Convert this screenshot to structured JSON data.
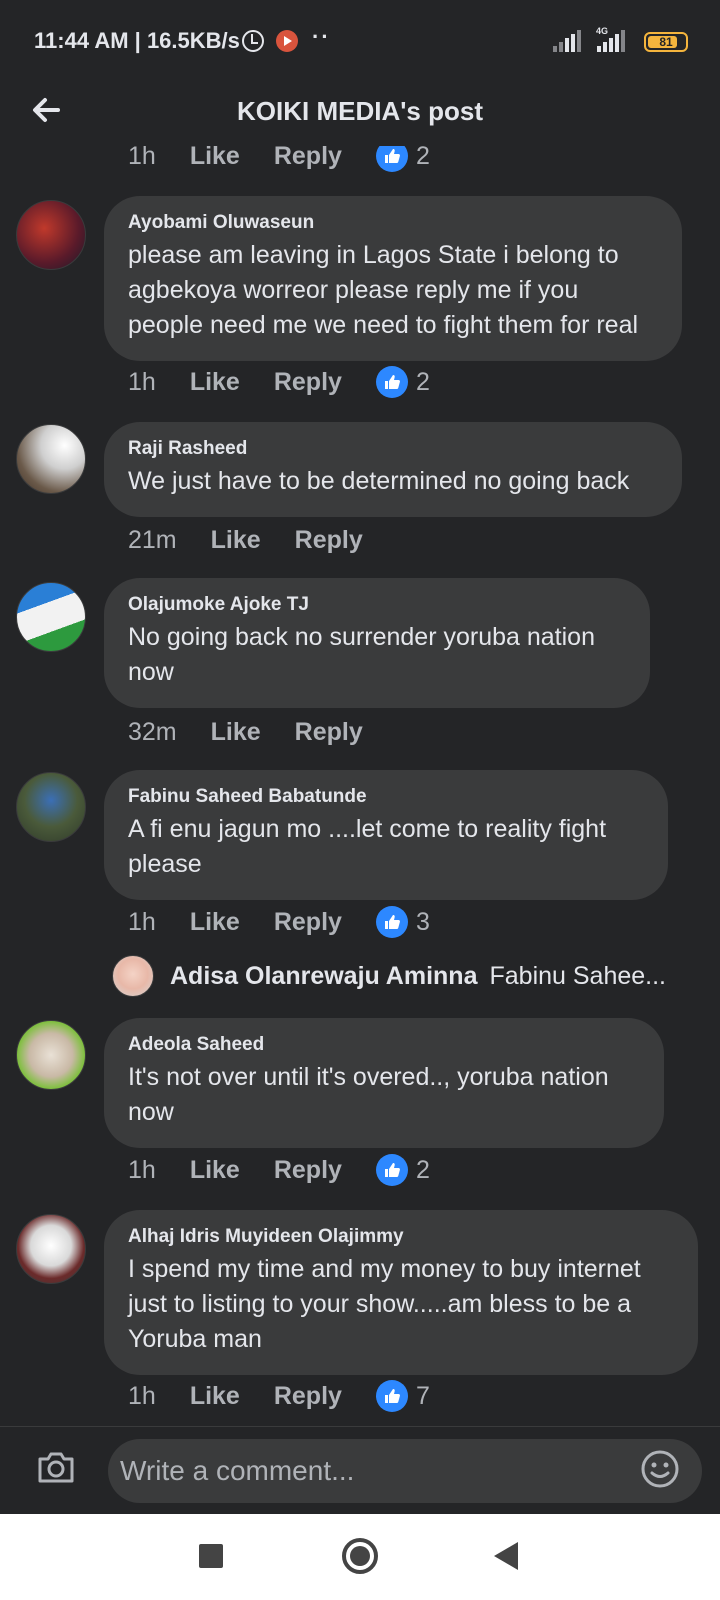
{
  "status_bar": {
    "time": "11:44 AM | 16.5KB/s",
    "more": "··",
    "network": "4G",
    "battery": "81",
    "battery_fraction": 0.81
  },
  "header": {
    "title": "KOIKI MEDIA's post",
    "back_icon": "back-arrow-icon"
  },
  "actions": {
    "like": "Like",
    "reply": "Reply"
  },
  "top_partial_meta": {
    "time": "1h",
    "reactions": "2"
  },
  "comments": [
    {
      "author": "Ayobami Oluwaseun",
      "text": "please am leaving in Lagos State i belong to agbekoya worreor please reply me if you people need me we need to fight them for real",
      "time": "1h",
      "reactions": "2"
    },
    {
      "author": "Raji Rasheed",
      "text": "We just have to be determined no going back",
      "time": "21m"
    },
    {
      "author": "Olajumoke Ajoke TJ",
      "text": "No going back no surrender yoruba nation now",
      "time": "32m"
    },
    {
      "author": "Fabinu Saheed Babatunde",
      "text": "A fi enu jagun mo ....let come to reality fight please",
      "time": "1h",
      "reactions": "3"
    },
    {
      "author": "Adeola Saheed",
      "text": "It's not over until it's overed.., yoruba nation now",
      "time": "1h",
      "reactions": "2"
    },
    {
      "author": "Alhaj Idris Muyideen Olajimmy",
      "text": "I spend my time and my money to buy internet just to listing to your show.....am bless to be a Yoruba man",
      "time": "1h",
      "reactions": "7"
    }
  ],
  "reply_preview": {
    "author": "Adisa Olanrewaju Aminna",
    "text": "Fabinu Sahee..."
  },
  "composer": {
    "placeholder": "Write a comment..."
  },
  "colors": {
    "background": "#242527",
    "bubble": "#3a3b3c",
    "like_blue": "#2d88ff",
    "battery": "#f5b53d"
  }
}
